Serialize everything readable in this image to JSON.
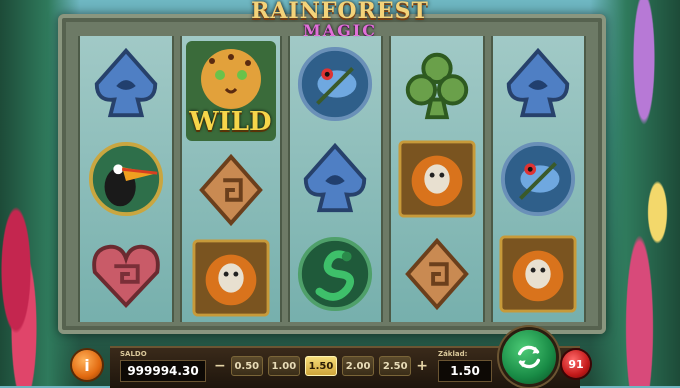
{
  "logo": {
    "line1": "RAINFOREST",
    "line2": "MAGIC"
  },
  "reels": [
    [
      "spade-blue",
      "toucan",
      "heart-stone"
    ],
    [
      "wild-jaguar",
      "diamond-stone",
      "monkey"
    ],
    [
      "frog",
      "spade-blue",
      "snake"
    ],
    [
      "club-green",
      "monkey",
      "diamond-stone"
    ],
    [
      "spade-blue",
      "frog",
      "monkey"
    ]
  ],
  "wild_label": "WILD",
  "bottom": {
    "info_label": "i",
    "saldo_label": "SALDO",
    "saldo_value": "999994.30",
    "minus_label": "−",
    "plus_label": "+",
    "bets": [
      "0.50",
      "1.00",
      "1.50",
      "2.00",
      "2.50"
    ],
    "selected_bet": "1.50",
    "zaklad_label": "Základ:",
    "zaklad_value": "1.50",
    "autoplay_count": "91"
  },
  "colors": {
    "spin": "#188a45",
    "accent": "#f6dd7a",
    "autoplay": "#c41a1a",
    "info": "#e26a10"
  }
}
